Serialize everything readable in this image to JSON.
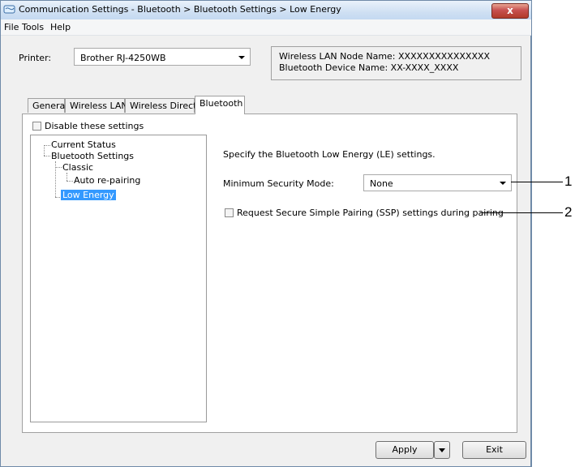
{
  "window": {
    "title": "Communication Settings - Bluetooth > Bluetooth Settings > Low Energy",
    "close_label": "x"
  },
  "menu": [
    "File",
    "Tools",
    "Help"
  ],
  "printer": {
    "label": "Printer:",
    "selected": "Brother RJ-4250WB"
  },
  "info": {
    "node_name": "Wireless LAN Node Name: XXXXXXXXXXXXXXX",
    "device_name": "Bluetooth Device Name: XX-XXXX_XXXX"
  },
  "tabs": [
    {
      "label": "General",
      "active": false
    },
    {
      "label": "Wireless LAN",
      "active": false
    },
    {
      "label": "Wireless Direct",
      "active": false
    },
    {
      "label": "Bluetooth",
      "active": true
    }
  ],
  "disable_settings": {
    "label": "Disable these settings",
    "checked": false
  },
  "tree": {
    "current_status": "Current Status",
    "bluetooth_settings": "Bluetooth Settings",
    "classic": "Classic",
    "auto_repairing": "Auto re-pairing",
    "low_energy": "Low Energy"
  },
  "content": {
    "description": "Specify the Bluetooth Low Energy (LE) settings.",
    "min_security_label": "Minimum Security Mode:",
    "min_security_value": "None",
    "ssp_label": "Request Secure Simple Pairing (SSP) settings during pairing",
    "ssp_checked": false
  },
  "buttons": {
    "apply": "Apply",
    "exit": "Exit"
  },
  "callouts": [
    "1",
    "2"
  ]
}
